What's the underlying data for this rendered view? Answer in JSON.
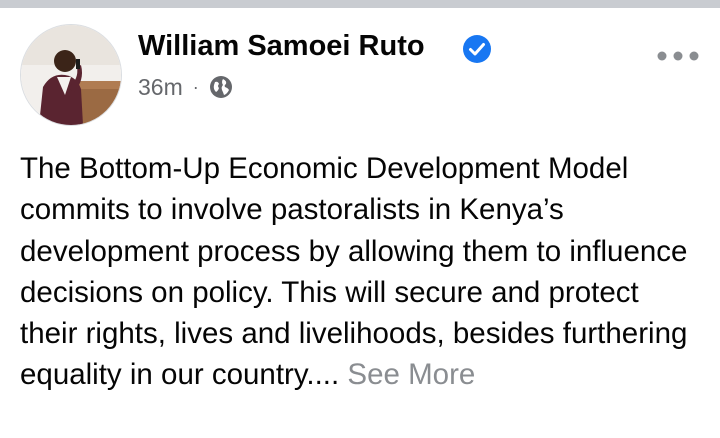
{
  "post": {
    "author_name": "William Samoei Ruto",
    "verified_icon": "verified-badge-icon",
    "timestamp": "36m",
    "separator": "·",
    "audience_icon": "globe-icon",
    "more_icon": "more-horizontal-icon",
    "text": "The Bottom-Up Economic Development Model commits to involve pastoralists in Kenya’s development process by allowing them to influence decisions on policy. This will secure and protect their rights, lives and livelihoods, besides furthering equality in our country....",
    "see_more_label": "See More"
  },
  "colors": {
    "name": "#050505",
    "meta": "#65676b",
    "verified": "#1877f2",
    "see_more": "#8a8d91",
    "top_strip": "#c9ccd1"
  }
}
